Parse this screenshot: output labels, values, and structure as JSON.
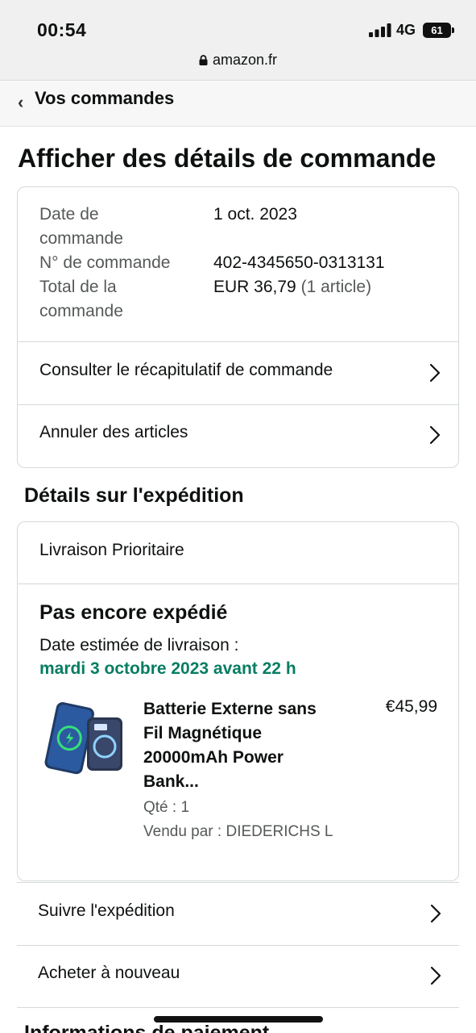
{
  "status_bar": {
    "time": "00:54",
    "network": "4G",
    "battery": "61"
  },
  "browser": {
    "url": "amazon.fr"
  },
  "nav": {
    "back_label": "Vos commandes"
  },
  "page_title": "Afficher des détails de commande",
  "order_summary": {
    "date_label_1": "Date de",
    "date_label_2": "commande",
    "date_value": "1 oct. 2023",
    "number_label": "N° de commande",
    "number_value": "402-4345650-0313131",
    "total_label_1": "Total de la",
    "total_label_2": "commande",
    "total_value": "EUR 36,79",
    "total_items": "(1 article)"
  },
  "order_actions": {
    "recap": "Consulter le récapitulatif de commande",
    "cancel": "Annuler des articles"
  },
  "shipping": {
    "section_title": "Détails sur l'expédition",
    "method": "Livraison Prioritaire",
    "status": "Pas encore expédié",
    "eta_label": "Date estimée de livraison :",
    "eta_value": "mardi 3 octobre 2023 avant 22 h",
    "product": {
      "title_line1": "Batterie Externe sans",
      "title_line2": "Fil Magnétique",
      "title_line3": "20000mAh Power",
      "title_line4": "Bank...",
      "price": "€45,99",
      "qty": "Qté : 1",
      "seller": "Vendu par : DIEDERICHS L"
    }
  },
  "shipment_actions": {
    "track": "Suivre l'expédition",
    "buy_again": "Acheter à nouveau"
  },
  "next_section_partial": "Informations de paiement"
}
